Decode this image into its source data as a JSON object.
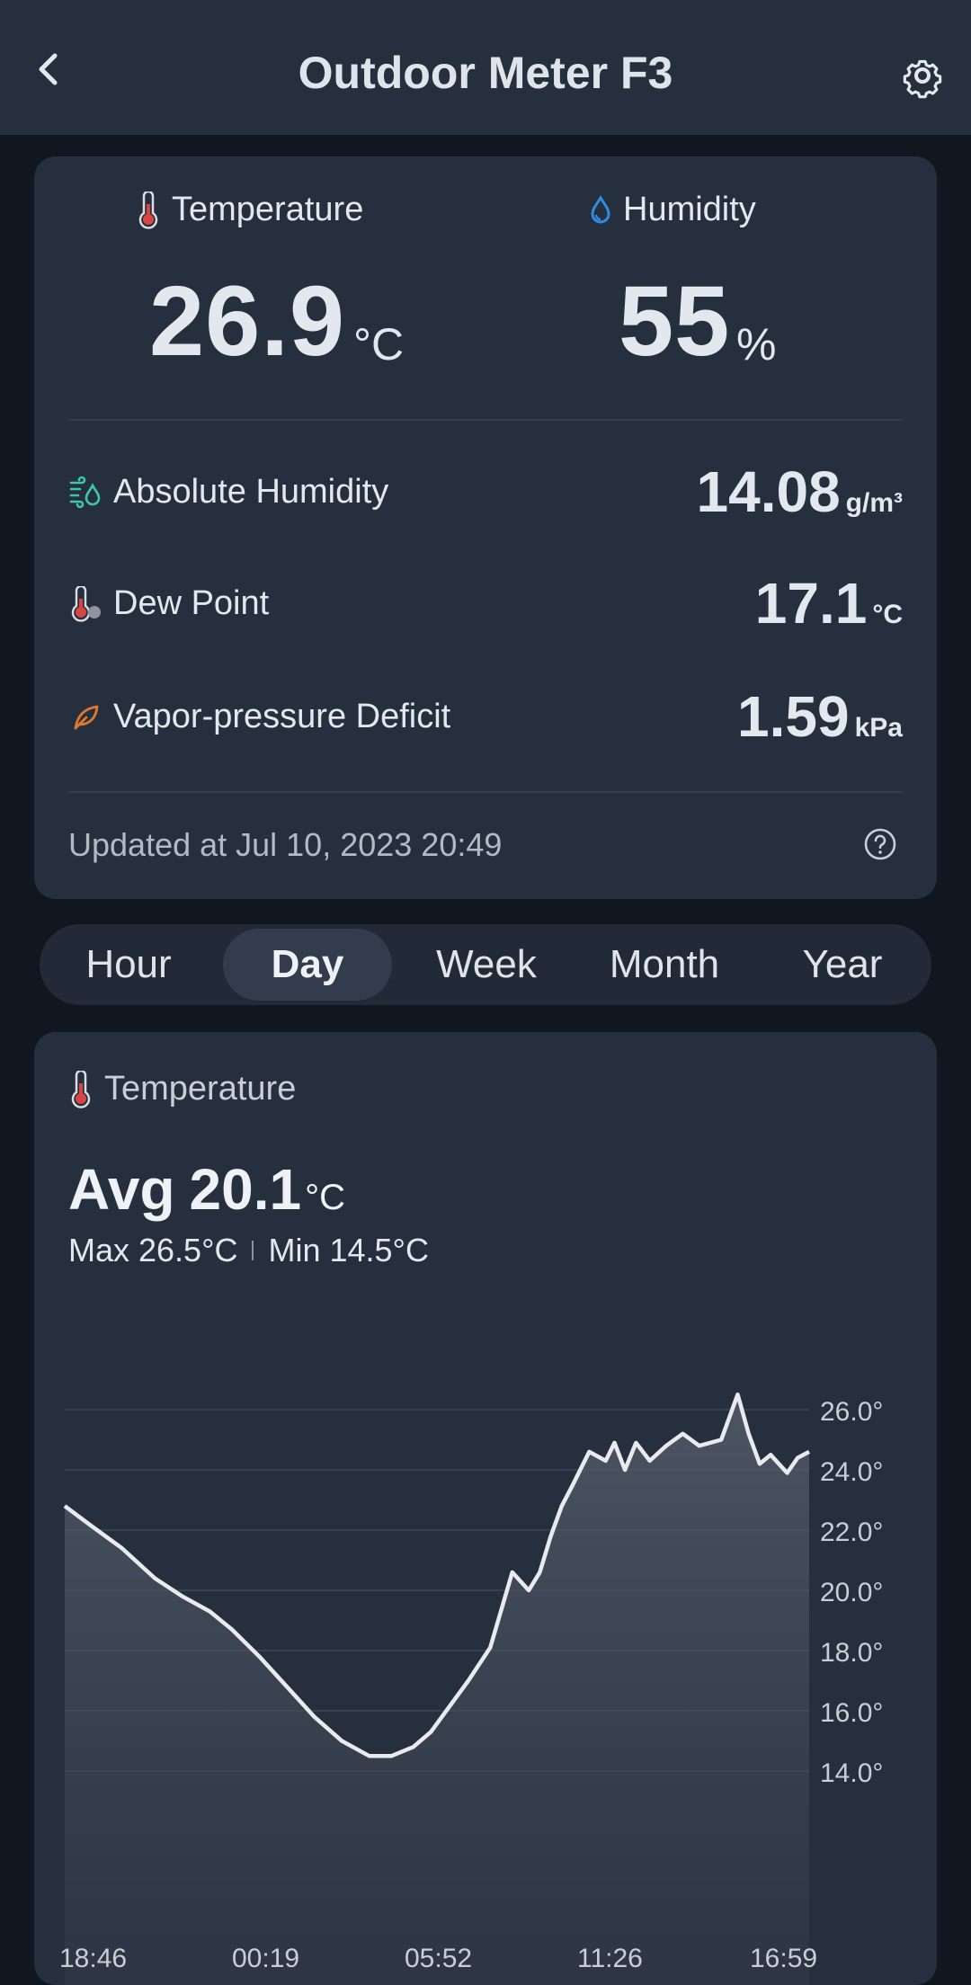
{
  "header": {
    "title": "Outdoor Meter F3",
    "back_icon": "chevron-left-icon",
    "settings_icon": "gear-icon"
  },
  "current": {
    "temperature": {
      "label": "Temperature",
      "value": "26.9",
      "unit": "°C",
      "icon": "thermometer-icon"
    },
    "humidity": {
      "label": "Humidity",
      "value": "55",
      "unit": "%",
      "icon": "water-drop-icon"
    }
  },
  "metrics": [
    {
      "label": "Absolute Humidity",
      "value": "14.08",
      "unit": "g/m³",
      "icon": "wind-drop-icon"
    },
    {
      "label": "Dew Point",
      "value": "17.1",
      "unit": "°C",
      "icon": "dew-point-icon"
    },
    {
      "label": "Vapor-pressure Deficit",
      "value": "1.59",
      "unit": "kPa",
      "icon": "leaf-icon"
    }
  ],
  "updated_text": "Updated at Jul 10, 2023 20:49",
  "tabs": {
    "items": [
      "Hour",
      "Day",
      "Week",
      "Month",
      "Year"
    ],
    "selected": "Day"
  },
  "chart_card": {
    "title": "Temperature",
    "avg_label": "Avg",
    "avg_value": "20.1",
    "avg_unit": "°C",
    "max_text": "Max 26.5°C",
    "min_text": "Min 14.5°C"
  },
  "colors": {
    "background": "#111720",
    "card": "#262f3d",
    "line": "#e8eaee",
    "temp_icon": "#d84545",
    "humidity_icon": "#2f8ce0",
    "abs_humidity_icon": "#3cc8a8",
    "vpd_icon": "#e07830"
  },
  "chart_data": {
    "type": "area",
    "title": "Temperature",
    "x_tick_labels": [
      "18:46",
      "00:19",
      "05:52",
      "11:26",
      "16:59"
    ],
    "y_tick_labels": [
      "26.0°",
      "24.0°",
      "22.0°",
      "20.0°",
      "18.0°",
      "16.0°",
      "14.0°"
    ],
    "ylim": [
      14.0,
      26.0
    ],
    "grid": true,
    "series": [
      {
        "x": [
          "18:46",
          "19:30",
          "20:30",
          "21:30",
          "22:20",
          "23:10",
          "23:50",
          "00:40",
          "01:30",
          "02:20",
          "03:10",
          "04:00",
          "04:40",
          "05:20",
          "05:52",
          "06:20",
          "07:00",
          "07:40",
          "08:20",
          "08:50",
          "09:10",
          "09:30",
          "09:50",
          "10:10",
          "10:40",
          "11:10",
          "11:26",
          "11:45",
          "12:05",
          "12:30",
          "13:00",
          "13:30",
          "14:00",
          "14:40",
          "15:10",
          "15:30",
          "15:50",
          "16:10",
          "16:40",
          "16:59",
          "17:20"
        ],
        "y": [
          22.8,
          22.2,
          21.4,
          20.4,
          19.8,
          19.3,
          18.7,
          17.8,
          16.8,
          15.8,
          15.0,
          14.5,
          14.5,
          14.8,
          15.3,
          16.0,
          17.0,
          18.1,
          20.6,
          20.0,
          20.6,
          21.8,
          22.8,
          23.5,
          24.6,
          24.3,
          24.9,
          24.0,
          24.9,
          24.3,
          24.8,
          25.2,
          24.8,
          25.0,
          26.5,
          25.2,
          24.2,
          24.5,
          23.9,
          24.4,
          24.6
        ]
      }
    ]
  }
}
